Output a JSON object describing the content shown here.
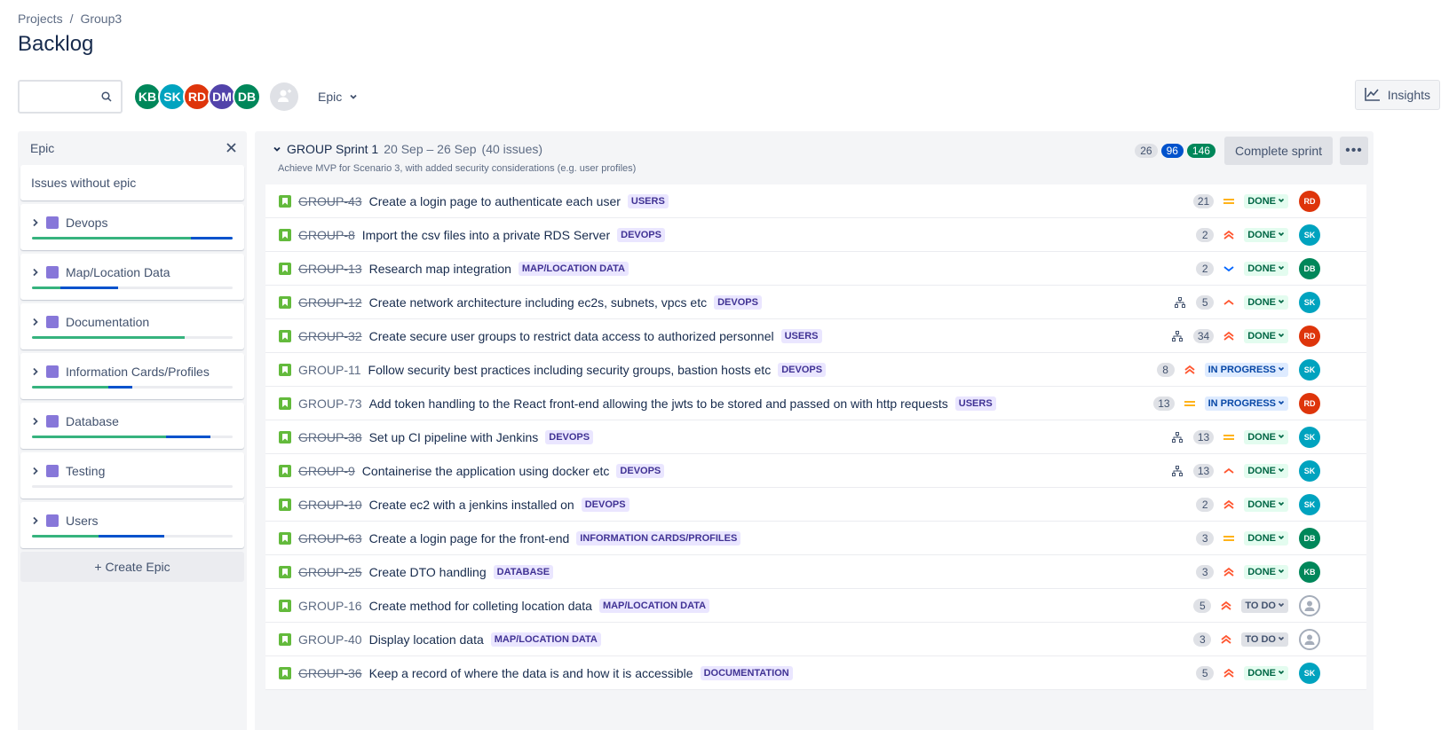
{
  "breadcrumb": {
    "projects": "Projects",
    "separator": "/",
    "project": "Group3"
  },
  "page_title": "Backlog",
  "toolbar": {
    "search_placeholder": "",
    "search_value": "",
    "avatars": [
      {
        "initials": "KB",
        "color": "#00875a"
      },
      {
        "initials": "SK",
        "color": "#00a3bf"
      },
      {
        "initials": "RD",
        "color": "#de350b"
      },
      {
        "initials": "DM",
        "color": "#5243aa"
      },
      {
        "initials": "DB",
        "color": "#00875a"
      }
    ],
    "epic_filter_label": "Epic",
    "insights_label": "Insights"
  },
  "epic_panel": {
    "title": "Epic",
    "issues_without_epic": "Issues without epic",
    "epics": [
      {
        "name": "Devops",
        "done": 0.79,
        "in_progress": 0.21
      },
      {
        "name": "Map/Location Data",
        "done": 0.14,
        "in_progress": 0.29
      },
      {
        "name": "Documentation",
        "done": 0.76,
        "in_progress": 0
      },
      {
        "name": "Information Cards/Profiles",
        "done": 0.38,
        "in_progress": 0.12
      },
      {
        "name": "Database",
        "done": 0.67,
        "in_progress": 0.22
      },
      {
        "name": "Testing",
        "done": 0,
        "in_progress": 0
      },
      {
        "name": "Users",
        "done": 0.33,
        "in_progress": 0.33
      }
    ],
    "create_epic_label": "+ Create Epic"
  },
  "sprint": {
    "name": "GROUP Sprint 1",
    "dates": "20 Sep – 26 Sep",
    "issue_count": "(40 issues)",
    "goal": "Achieve MVP for Scenario 3, with added security considerations (e.g. user profiles)",
    "points_todo": "26",
    "points_in_progress": "96",
    "points_done": "146",
    "complete_label": "Complete sprint",
    "more_label": "•••"
  },
  "avatar_colors": {
    "RD": "#de350b",
    "SK": "#00a3bf",
    "DB": "#00875a",
    "KB": "#00875a"
  },
  "issues": [
    {
      "key": "GROUP-43",
      "summary": "Create a login page to authenticate each user",
      "epic": "USERS",
      "children": false,
      "points": "21",
      "priority": "medium",
      "status": "DONE",
      "assignee": "RD",
      "resolved": true
    },
    {
      "key": "GROUP-8",
      "summary": "Import the csv files into a private RDS Server",
      "epic": "DEVOPS",
      "children": false,
      "points": "2",
      "priority": "highest",
      "status": "DONE",
      "assignee": "SK",
      "resolved": true
    },
    {
      "key": "GROUP-13",
      "summary": "Research map integration",
      "epic": "MAP/LOCATION DATA",
      "children": false,
      "points": "2",
      "priority": "low",
      "status": "DONE",
      "assignee": "DB",
      "resolved": true
    },
    {
      "key": "GROUP-12",
      "summary": "Create network architecture including ec2s, subnets, vpcs etc",
      "epic": "DEVOPS",
      "children": true,
      "points": "5",
      "priority": "high",
      "status": "DONE",
      "assignee": "SK",
      "resolved": true
    },
    {
      "key": "GROUP-32",
      "summary": "Create secure user groups to restrict data access to authorized personnel",
      "epic": "USERS",
      "children": true,
      "points": "34",
      "priority": "highest",
      "status": "DONE",
      "assignee": "RD",
      "resolved": true
    },
    {
      "key": "GROUP-11",
      "summary": "Follow security best practices including security groups, bastion hosts etc",
      "epic": "DEVOPS",
      "children": false,
      "points": "8",
      "priority": "highest",
      "status": "IN PROGRESS",
      "assignee": "SK",
      "resolved": false
    },
    {
      "key": "GROUP-73",
      "summary": "Add token handling to the React front-end allowing the jwts to be stored and passed on with http requests",
      "epic": "USERS",
      "children": false,
      "points": "13",
      "priority": "medium",
      "status": "IN PROGRESS",
      "assignee": "RD",
      "resolved": false
    },
    {
      "key": "GROUP-38",
      "summary": "Set up CI pipeline with Jenkins",
      "epic": "DEVOPS",
      "children": true,
      "points": "13",
      "priority": "medium",
      "status": "DONE",
      "assignee": "SK",
      "resolved": true
    },
    {
      "key": "GROUP-9",
      "summary": "Containerise the application using docker etc",
      "epic": "DEVOPS",
      "children": true,
      "points": "13",
      "priority": "high",
      "status": "DONE",
      "assignee": "SK",
      "resolved": true
    },
    {
      "key": "GROUP-10",
      "summary": "Create ec2 with a jenkins installed on",
      "epic": "DEVOPS",
      "children": false,
      "points": "2",
      "priority": "highest",
      "status": "DONE",
      "assignee": "SK",
      "resolved": true
    },
    {
      "key": "GROUP-63",
      "summary": "Create a login page for the front-end",
      "epic": "INFORMATION CARDS/PROFILES",
      "children": false,
      "points": "3",
      "priority": "medium",
      "status": "DONE",
      "assignee": "DB",
      "resolved": true
    },
    {
      "key": "GROUP-25",
      "summary": "Create DTO handling",
      "epic": "DATABASE",
      "children": false,
      "points": "3",
      "priority": "highest",
      "status": "DONE",
      "assignee": "KB",
      "resolved": true
    },
    {
      "key": "GROUP-16",
      "summary": "Create method for colleting location data",
      "epic": "MAP/LOCATION DATA",
      "children": false,
      "points": "5",
      "priority": "highest",
      "status": "TO DO",
      "assignee": "",
      "resolved": false
    },
    {
      "key": "GROUP-40",
      "summary": "Display location data",
      "epic": "MAP/LOCATION DATA",
      "children": false,
      "points": "3",
      "priority": "highest",
      "status": "TO DO",
      "assignee": "",
      "resolved": false
    },
    {
      "key": "GROUP-36",
      "summary": "Keep a record of where the data is and how it is accessible",
      "epic": "DOCUMENTATION",
      "children": false,
      "points": "5",
      "priority": "highest",
      "status": "DONE",
      "assignee": "SK",
      "resolved": true
    }
  ]
}
